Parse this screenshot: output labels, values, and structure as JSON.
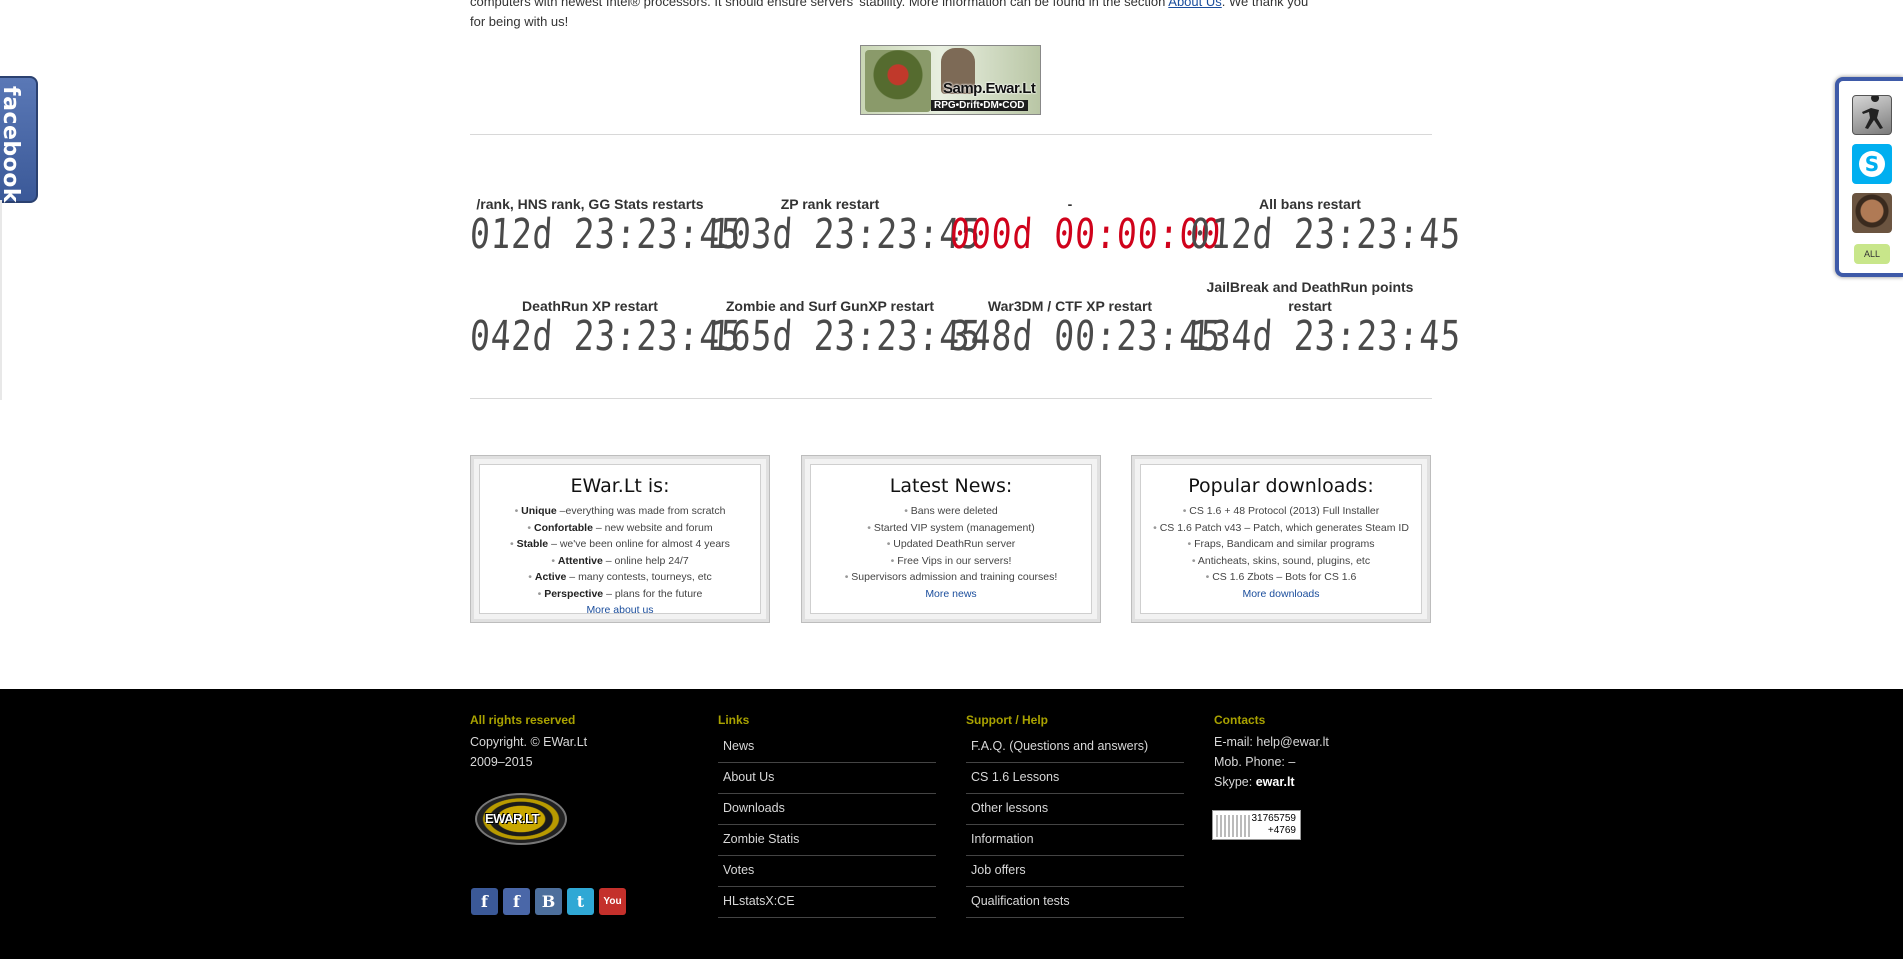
{
  "intro": {
    "line1": "computers with newest Intel® processors. It should ensure servers' stability. More information can be found in the section",
    "link": "About Us",
    "line1_end": ". We thank you",
    "line2": "for being with us!"
  },
  "banner": {
    "title": "Samp.Ewar.Lt",
    "subtitle": "RPG•Drift•DM•COD"
  },
  "timers": [
    {
      "label": "/rank, HNS rank, GG Stats restarts",
      "value": "012d 23:23:45",
      "red": false
    },
    {
      "label": "ZP rank restart",
      "value": "103d 23:23:45",
      "red": false
    },
    {
      "label": "-",
      "value": "000d 00:00:00",
      "red": true
    },
    {
      "label": "All bans restart",
      "value": "012d 23:23:45",
      "red": false
    },
    {
      "label": "DeathRun XP restart",
      "value": "042d 23:23:45",
      "red": false
    },
    {
      "label": "Zombie and Surf GunXP restart",
      "value": "165d 23:23:45",
      "red": false
    },
    {
      "label": "War3DM / CTF XP restart",
      "value": "348d 00:23:45",
      "red": false
    },
    {
      "label": "JailBreak and DeathRun points restart",
      "value": "134d 23:23:45",
      "red": false
    }
  ],
  "boxes": {
    "about": {
      "title": "EWar.Lt is:",
      "items": [
        {
          "b": "Unique",
          "t": " –everything was made from scratch"
        },
        {
          "b": "Confortable",
          "t": " – new website and forum"
        },
        {
          "b": "Stable",
          "t": " – we've been online for almost 4 years"
        },
        {
          "b": "Attentive",
          "t": " – online help 24/7"
        },
        {
          "b": "Active",
          "t": " – many contests, tourneys, etc"
        },
        {
          "b": "Perspective",
          "t": " – plans for the future"
        }
      ],
      "more": "More about us"
    },
    "news": {
      "title": "Latest News:",
      "items": [
        "Bans were deleted",
        "Started VIP system (management)",
        "Updated DeathRun server",
        "Free Vips in our servers!",
        "Supervisors admission and training courses!"
      ],
      "more": "More news"
    },
    "downloads": {
      "title": "Popular downloads:",
      "items": [
        "CS 1.6 + 48 Protocol (2013) Full Installer",
        "CS 1.6 Patch v43 – Patch, which generates Steam ID",
        "Fraps, Bandicam and similar programs",
        "Anticheats, skins, sound, plugins, etc",
        "CS 1.6 Zbots – Bots for CS 1.6"
      ],
      "more": "More downloads"
    }
  },
  "footer": {
    "rights": {
      "head": "All rights reserved",
      "copy": "Copyright. © EWar.Lt",
      "years": "2009–2015"
    },
    "logo_text": "EWAR.LT",
    "links": {
      "head": "Links",
      "items": [
        "News",
        "About Us",
        "Downloads",
        "Zombie Statis",
        "Votes",
        "HLstatsX:CE"
      ]
    },
    "support": {
      "head": "Support / Help",
      "items": [
        "F.A.Q. (Questions and answers)",
        "CS 1.6 Lessons",
        "Other lessons",
        "Information",
        "Job offers",
        "Qualification tests"
      ]
    },
    "contacts": {
      "head": "Contacts",
      "email_label": "E-mail: ",
      "email": "help@ewar.lt",
      "phone": "Mob. Phone: –",
      "skype_label": "Skype: ",
      "skype": "ewar.lt"
    },
    "counter": {
      "total": "31765759",
      "today": "+4769"
    },
    "social": [
      "f",
      "f",
      "B",
      "t",
      "You"
    ]
  },
  "facebook_tab": "facebook",
  "side_panel": {
    "all_label": "ALL"
  }
}
